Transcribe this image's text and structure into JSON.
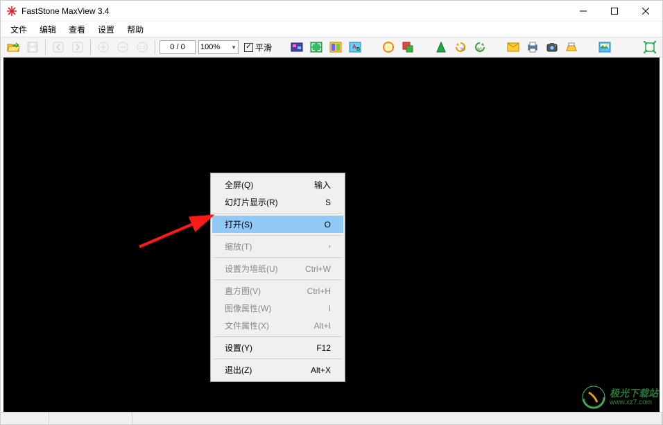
{
  "window": {
    "title": "FastStone MaxView 3.4"
  },
  "menubar": {
    "file": "文件",
    "edit": "编辑",
    "view": "查看",
    "settings": "设置",
    "help": "帮助"
  },
  "toolbar": {
    "page_display": "0 / 0",
    "zoom_value": "100%",
    "smooth_label": "平滑",
    "smooth_checked": "✓"
  },
  "context_menu": {
    "fullscreen": {
      "label": "全屏(Q)",
      "shortcut": "输入"
    },
    "slideshow": {
      "label": "幻灯片显示(R)",
      "shortcut": "S"
    },
    "open": {
      "label": "打开(S)",
      "shortcut": "O"
    },
    "zoom": {
      "label": "缩放(T)",
      "shortcut": "›"
    },
    "wallpaper": {
      "label": "设置为墙纸(U)",
      "shortcut": "Ctrl+W"
    },
    "histogram": {
      "label": "直方图(V)",
      "shortcut": "Ctrl+H"
    },
    "img_props": {
      "label": "图像属性(W)",
      "shortcut": "I"
    },
    "file_props": {
      "label": "文件属性(X)",
      "shortcut": "Alt+I"
    },
    "settings": {
      "label": "设置(Y)",
      "shortcut": "F12"
    },
    "exit": {
      "label": "退出(Z)",
      "shortcut": "Alt+X"
    }
  },
  "watermark": {
    "zh": "极光下载站",
    "url": "www.xz7.com"
  }
}
